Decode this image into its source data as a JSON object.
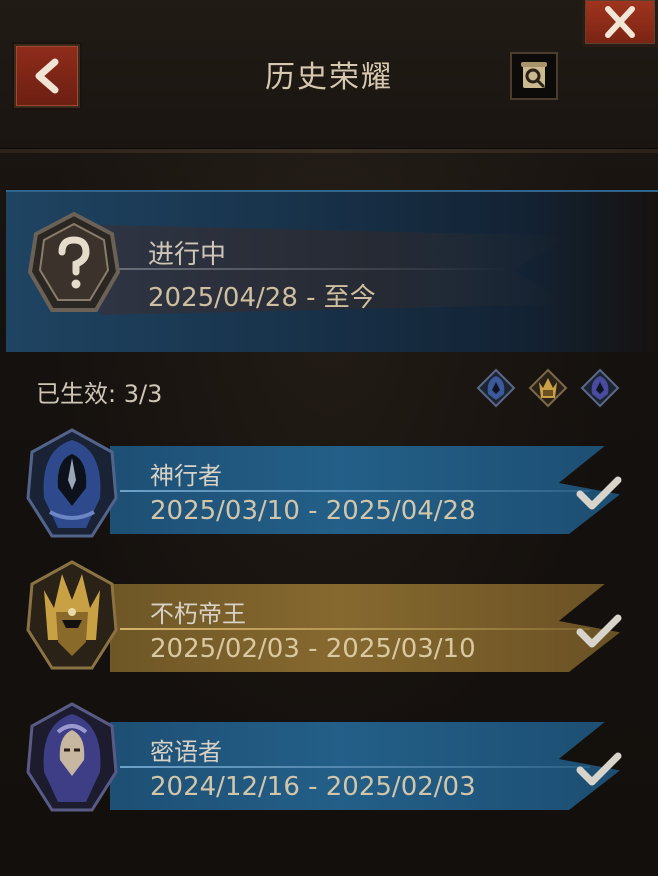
{
  "header": {
    "title": "历史荣耀",
    "back_icon": "chevron-left-icon",
    "close_icon": "close-icon",
    "log_icon": "scroll-search-icon"
  },
  "current": {
    "status": "进行中",
    "date_range": "2025/04/28 - 至今",
    "emblem_icon": "question-mark-emblem-icon"
  },
  "effective": {
    "label": "已生效: 3/3",
    "icons": [
      "blue-hood-icon",
      "gold-crown-icon",
      "blue-hood-icon"
    ]
  },
  "records": [
    {
      "name": "神行者",
      "date_range": "2025/03/10 - 2025/04/28",
      "theme": "blue",
      "completed": true
    },
    {
      "name": "不朽帝王",
      "date_range": "2025/02/03 - 2025/03/10",
      "theme": "gold",
      "completed": true
    },
    {
      "name": "密语者",
      "date_range": "2024/12/16 - 2025/02/03",
      "theme": "blue",
      "completed": true
    }
  ],
  "colors": {
    "blue_banner": "#235f88",
    "gold_banner": "#86692f",
    "button_red": "#8f2c1b",
    "background": "#16120f"
  }
}
